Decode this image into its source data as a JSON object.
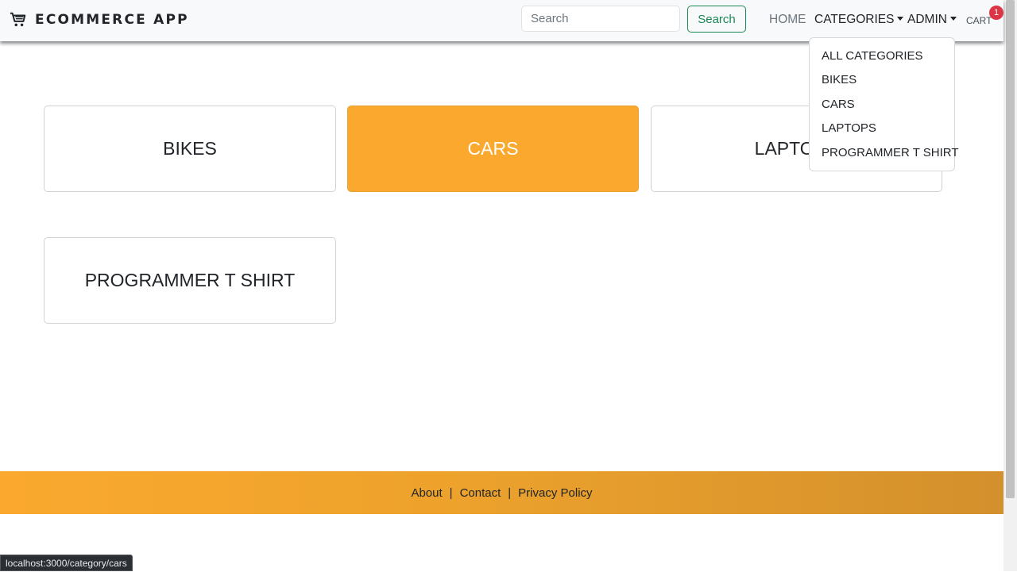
{
  "brand": {
    "name": "ECOMMERCE APP",
    "icon": "shopping-cart-icon"
  },
  "search": {
    "placeholder": "Search",
    "value": "",
    "button_label": "Search"
  },
  "nav": {
    "home": "HOME",
    "categories": "CATEGORIES",
    "admin": "ADMIN",
    "cart": "CART",
    "cart_count": "1"
  },
  "dropdown": {
    "items": [
      "ALL CATEGORIES",
      "BIKES",
      "CARS",
      "LAPTOPS",
      "PROGRAMMER T SHIRT"
    ]
  },
  "categories": [
    {
      "label": "BIKES",
      "active": false
    },
    {
      "label": "CARS",
      "active": true
    },
    {
      "label": "LAPTOPS",
      "active": false
    },
    {
      "label": "PROGRAMMER T SHIRT",
      "active": false
    }
  ],
  "footer": {
    "links": [
      "About",
      "Contact",
      "Privacy Policy"
    ],
    "separator": "|"
  },
  "status_bar": {
    "url": "localhost:3000/category/cars"
  },
  "colors": {
    "accent": "#faa92e",
    "search_button": "#198754",
    "badge": "#dc3545",
    "navbar_bg": "#f8f9fa"
  }
}
